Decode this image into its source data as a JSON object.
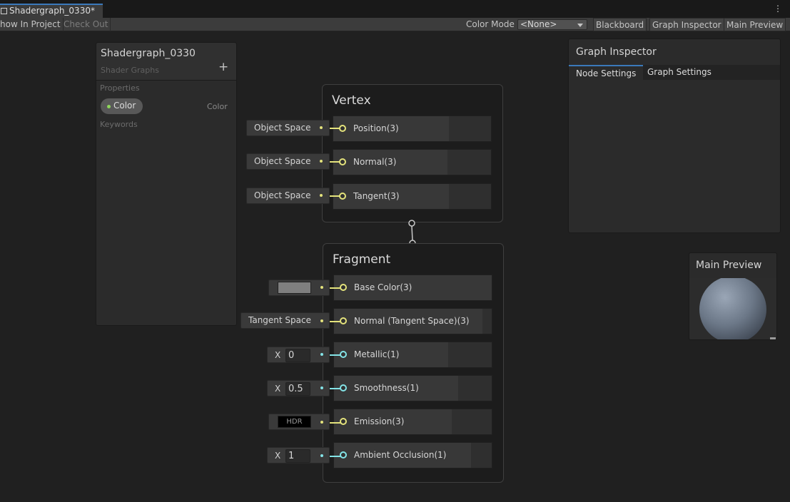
{
  "tab": {
    "title": "Shadergraph_0330*"
  },
  "toolbar": {
    "show_in_project": "how In Project",
    "check_out": "Check Out",
    "color_mode_label": "Color Mode",
    "color_mode_value": "<None>",
    "blackboard": "Blackboard",
    "graph_inspector": "Graph Inspector",
    "main_preview": "Main Preview"
  },
  "blackboard": {
    "title": "Shadergraph_0330",
    "subtitle": "Shader Graphs",
    "add": "+",
    "properties_label": "Properties",
    "property": {
      "name": "Color",
      "type": "Color",
      "color": "#8ed65a"
    },
    "keywords_label": "Keywords"
  },
  "vertex": {
    "title": "Vertex",
    "blocks": [
      {
        "label": "Position(3)",
        "input": "Object Space"
      },
      {
        "label": "Normal(3)",
        "input": "Object Space"
      },
      {
        "label": "Tangent(3)",
        "input": "Object Space"
      }
    ]
  },
  "fragment": {
    "title": "Fragment",
    "blocks": [
      {
        "label": "Base Color(3)",
        "input_kind": "color",
        "swatch": "#7f7f7f"
      },
      {
        "label": "Normal (Tangent Space)(3)",
        "input": "Tangent Space"
      },
      {
        "label": "Metallic(1)",
        "x_label": "X",
        "value": "0"
      },
      {
        "label": "Smoothness(1)",
        "x_label": "X",
        "value": "0.5"
      },
      {
        "label": "Emission(3)",
        "input": "HDR"
      },
      {
        "label": "Ambient Occlusion(1)",
        "x_label": "X",
        "value": "1"
      }
    ]
  },
  "inspector": {
    "title": "Graph Inspector",
    "tabs": [
      "Node Settings",
      "Graph Settings"
    ]
  },
  "preview": {
    "title": "Main Preview"
  },
  "colors": {
    "vector3_port": "#e4e37c",
    "float_port": "#84e4e7",
    "accent": "#3a79bb"
  }
}
